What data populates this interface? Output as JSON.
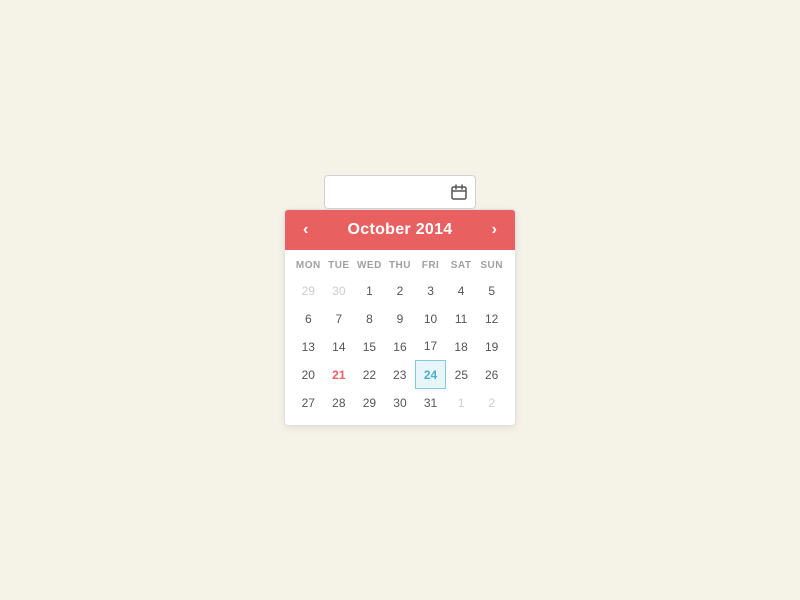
{
  "input": {
    "placeholder": "",
    "value": ""
  },
  "calendar": {
    "month_year": "October 2014",
    "prev_label": "‹",
    "next_label": "›",
    "icon": "📅",
    "weekdays": [
      "MON",
      "TUE",
      "WED",
      "THU",
      "FRI",
      "SAT",
      "SUN"
    ],
    "weeks": [
      [
        {
          "day": "29",
          "type": "other-month"
        },
        {
          "day": "30",
          "type": "other-month"
        },
        {
          "day": "1",
          "type": "normal"
        },
        {
          "day": "2",
          "type": "normal"
        },
        {
          "day": "3",
          "type": "normal"
        },
        {
          "day": "4",
          "type": "normal"
        },
        {
          "day": "5",
          "type": "normal"
        }
      ],
      [
        {
          "day": "6",
          "type": "normal"
        },
        {
          "day": "7",
          "type": "normal"
        },
        {
          "day": "8",
          "type": "normal"
        },
        {
          "day": "9",
          "type": "normal"
        },
        {
          "day": "10",
          "type": "normal"
        },
        {
          "day": "11",
          "type": "normal"
        },
        {
          "day": "12",
          "type": "normal"
        }
      ],
      [
        {
          "day": "13",
          "type": "normal"
        },
        {
          "day": "14",
          "type": "normal"
        },
        {
          "day": "15",
          "type": "normal"
        },
        {
          "day": "16",
          "type": "normal"
        },
        {
          "day": "17",
          "type": "normal"
        },
        {
          "day": "18",
          "type": "normal"
        },
        {
          "day": "19",
          "type": "normal"
        }
      ],
      [
        {
          "day": "20",
          "type": "normal"
        },
        {
          "day": "21",
          "type": "highlighted"
        },
        {
          "day": "22",
          "type": "normal"
        },
        {
          "day": "23",
          "type": "normal"
        },
        {
          "day": "24",
          "type": "selected"
        },
        {
          "day": "25",
          "type": "normal"
        },
        {
          "day": "26",
          "type": "normal"
        }
      ],
      [
        {
          "day": "27",
          "type": "normal"
        },
        {
          "day": "28",
          "type": "normal"
        },
        {
          "day": "29",
          "type": "normal"
        },
        {
          "day": "30",
          "type": "normal"
        },
        {
          "day": "31",
          "type": "normal"
        },
        {
          "day": "1",
          "type": "other-month"
        },
        {
          "day": "2",
          "type": "other-month"
        }
      ]
    ]
  }
}
